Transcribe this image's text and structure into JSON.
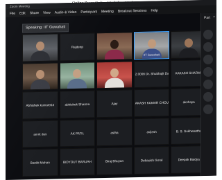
{
  "caption": "Online Zoom Online Workshop Moderation",
  "window": {
    "title": "Zoom Meeting"
  },
  "menu": [
    "File",
    "Edit",
    "Share",
    "View",
    "Audio & Video",
    "Participant",
    "Meeting",
    "Breakout Sessions",
    "Help"
  ],
  "speaking": "Speaking: IIT Guwahati",
  "tiles": [
    {
      "name": "",
      "video": true
    },
    {
      "name": "Rajdeep",
      "video": false
    },
    {
      "name": "",
      "video": true
    },
    {
      "name": "IIT Guwahati",
      "video": true
    },
    {
      "name": "",
      "video": true
    },
    {
      "name": "",
      "video": true
    },
    {
      "name": "",
      "video": true
    },
    {
      "name": "",
      "video": true
    },
    {
      "name": "2.0008 Dr. Shubhajit Das",
      "video": false
    },
    {
      "name": "AAKASH SHARMA",
      "video": false
    },
    {
      "name": "Abhishek kumar013",
      "video": false
    },
    {
      "name": "abhishek Sharma",
      "video": false
    },
    {
      "name": "Ajay",
      "video": false
    },
    {
      "name": "AKASH KUMAR CHOUDHARY",
      "video": false
    },
    {
      "name": "akshaya",
      "video": false
    },
    {
      "name": "amrit das",
      "video": false
    },
    {
      "name": "AK PATIL",
      "video": false
    },
    {
      "name": "astha",
      "video": false
    },
    {
      "name": "avijesh",
      "video": false
    },
    {
      "name": "B. S. Sukhwantha",
      "video": false
    },
    {
      "name": "Banibi Mohan",
      "video": false
    },
    {
      "name": "BIDYOUT BARUAH",
      "video": false
    },
    {
      "name": "Biraj Bhuyan",
      "video": false
    },
    {
      "name": "Debasish Goral",
      "video": false
    },
    {
      "name": "Deepak Baidya",
      "video": false
    }
  ],
  "sidebar": {
    "title": "Part",
    "close": "×"
  }
}
